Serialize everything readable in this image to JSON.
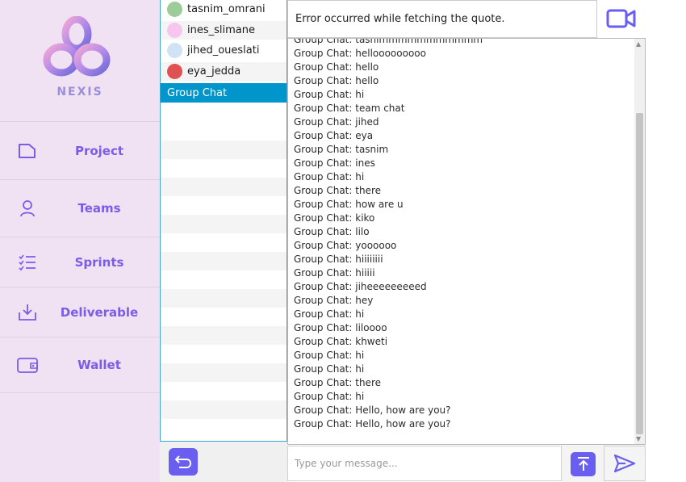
{
  "brand": {
    "name": "NEXIS"
  },
  "colors": {
    "accent": "#6a5ef0",
    "sidebar_bg": "#f0e2f3",
    "nav_text": "#7a5ce6",
    "selected_row": "#0096cc"
  },
  "nav": [
    {
      "label": "Project",
      "icon": "file-icon"
    },
    {
      "label": "Teams",
      "icon": "user-icon"
    },
    {
      "label": "Sprints",
      "icon": "checklist-icon"
    },
    {
      "label": "Deliverable",
      "icon": "download-icon"
    },
    {
      "label": "Wallet",
      "icon": "wallet-icon"
    }
  ],
  "users": [
    {
      "name": "tasnim_omrani",
      "avatar_color": "#9ccc9a"
    },
    {
      "name": "ines_slimane",
      "avatar_color": "#f6c6ef"
    },
    {
      "name": "jihed_oueslati",
      "avatar_color": "#cfe3f5"
    },
    {
      "name": "eya_jedda",
      "avatar_color": "#e05252"
    }
  ],
  "group_chat_label": "Group Chat",
  "quote": {
    "text": "Error occurred while fetching the quote."
  },
  "messages": [
    "Group Chat: tasnimmmmmmmmmmm",
    "Group Chat: hellooooooooo",
    "Group Chat: hello",
    "Group Chat: hello",
    "Group Chat: hi",
    "Group Chat: team chat",
    "Group Chat: jihed",
    "Group Chat: eya",
    "Group Chat: tasnim",
    "Group Chat: ines",
    "Group Chat: hi",
    "Group Chat: there",
    "Group Chat: how are u",
    "Group Chat: kiko",
    "Group Chat: lilo",
    "Group Chat: yoooooo",
    "Group Chat: hiiiiiiii",
    "Group Chat: hiiiii",
    "Group Chat: jiheeeeeeeeed",
    "Group Chat: hey",
    "Group Chat: hi",
    "Group Chat: liloooo",
    "Group Chat: khweti",
    "Group Chat: hi",
    "Group Chat: hi",
    "Group Chat: there",
    "Group Chat: hi",
    "Group Chat: Hello, how are you?",
    "Group Chat: Hello, how are you?"
  ],
  "input": {
    "placeholder": "Type your message...",
    "value": ""
  }
}
